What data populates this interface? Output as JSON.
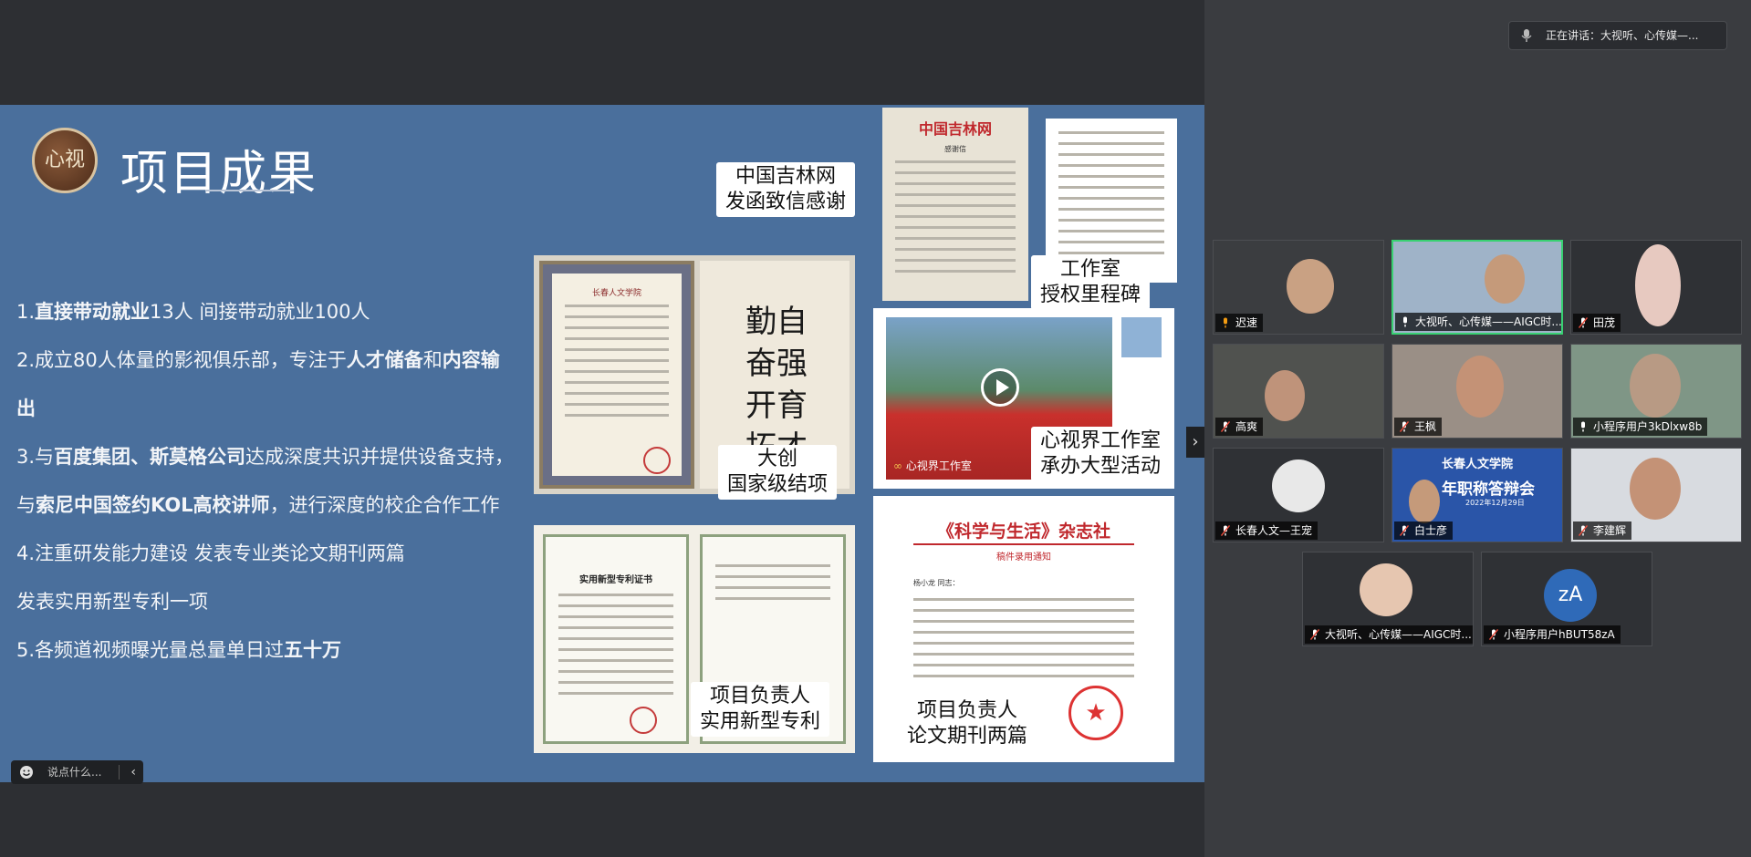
{
  "speaker": {
    "text": "正在讲话：大视听、心传媒—..."
  },
  "slide": {
    "logo_text": "心视",
    "title": "项目成果",
    "bullets": [
      {
        "parts": [
          {
            "t": "1.",
            "b": false
          },
          {
            "t": "直接带动就业",
            "b": true
          },
          {
            "t": "13人 间接带动就业100人",
            "b": false
          }
        ]
      },
      {
        "parts": [
          {
            "t": "2.成立80人体量的影视俱乐部，专注于",
            "b": false
          },
          {
            "t": "人才储备",
            "b": true
          },
          {
            "t": "和",
            "b": false
          },
          {
            "t": "内容输",
            "b": true
          }
        ]
      },
      {
        "parts": [
          {
            "t": "出",
            "b": true
          }
        ]
      },
      {
        "parts": [
          {
            "t": "3.与",
            "b": false
          },
          {
            "t": "百度集团、斯莫格公司",
            "b": true
          },
          {
            "t": "达成深度共识并提供设备支持，",
            "b": false
          }
        ]
      },
      {
        "parts": [
          {
            "t": "与",
            "b": false
          },
          {
            "t": "索尼中国签约KOL高校讲师",
            "b": true
          },
          {
            "t": "，进行深度的校企合作工作",
            "b": false
          }
        ]
      },
      {
        "parts": [
          {
            "t": "4.注重研发能力建设 发表专业类论文期刊两篇",
            "b": false
          }
        ]
      },
      {
        "parts": [
          {
            "t": "发表实用新型专利一项",
            "b": false
          }
        ]
      },
      {
        "parts": [
          {
            "t": "5.各频道视频曝光量总量单日过",
            "b": false
          },
          {
            "t": "五十万",
            "b": true
          }
        ]
      }
    ],
    "captions": {
      "jilin": [
        "中国吉林网",
        "发函致信感谢"
      ],
      "studio": [
        "工作室",
        "授权里程碑"
      ],
      "dachuang": [
        "大创",
        "国家级结项"
      ],
      "event": [
        "心视界工作室",
        "承办大型活动"
      ],
      "patent": [
        "项目负责人",
        "实用新型专利"
      ],
      "paper": [
        "项目负责人",
        "论文期刊两篇"
      ]
    },
    "doc_texts": {
      "jilin_header": "中国吉林网",
      "jilin_sub": "感谢信",
      "cert_header": "长春人文学院",
      "calligraphy": [
        "勤",
        "奋",
        "开",
        "拓",
        "自",
        "强",
        "育",
        "才"
      ],
      "video_watermark": "心视界工作室",
      "patent_title": "实用新型专利证书",
      "magazine_title": "《科学与生活》杂志社",
      "magazine_sub": "稿件录用通知",
      "magazine_greeting": "杨小龙 同志："
    }
  },
  "participants": [
    {
      "name": "迟速",
      "active": false,
      "mic": "host"
    },
    {
      "name": "大视听、心传媒——AIGC时...",
      "active": true,
      "mic": "on"
    },
    {
      "name": "田茂",
      "active": false,
      "mic": "muted"
    },
    {
      "name": "高爽",
      "active": false,
      "mic": "muted"
    },
    {
      "name": "王枫",
      "active": false,
      "mic": "muted"
    },
    {
      "name": "小程序用户3kDlxw8b",
      "active": false,
      "mic": "on"
    },
    {
      "name": "长春人文—王宠",
      "active": false,
      "mic": "muted"
    },
    {
      "name": "白士彦",
      "active": false,
      "mic": "muted"
    },
    {
      "name": "李建辉",
      "active": false,
      "mic": "muted"
    },
    {
      "name": "大视听、心传媒——AIGC时...",
      "active": false,
      "mic": "muted"
    },
    {
      "name": "小程序用户hBUT58zA",
      "active": false,
      "mic": "muted",
      "avatar": "zA"
    }
  ],
  "tile_texts": {
    "school_banner": "长春人文学院",
    "school_event": "年职称答辩会",
    "school_date": "2022年12月29日"
  },
  "chat": {
    "placeholder": "说点什么..."
  },
  "colors": {
    "slide_bg": "#4a6f9c",
    "active_border": "#38d172",
    "avatar_bg": "#2f6ab8"
  }
}
